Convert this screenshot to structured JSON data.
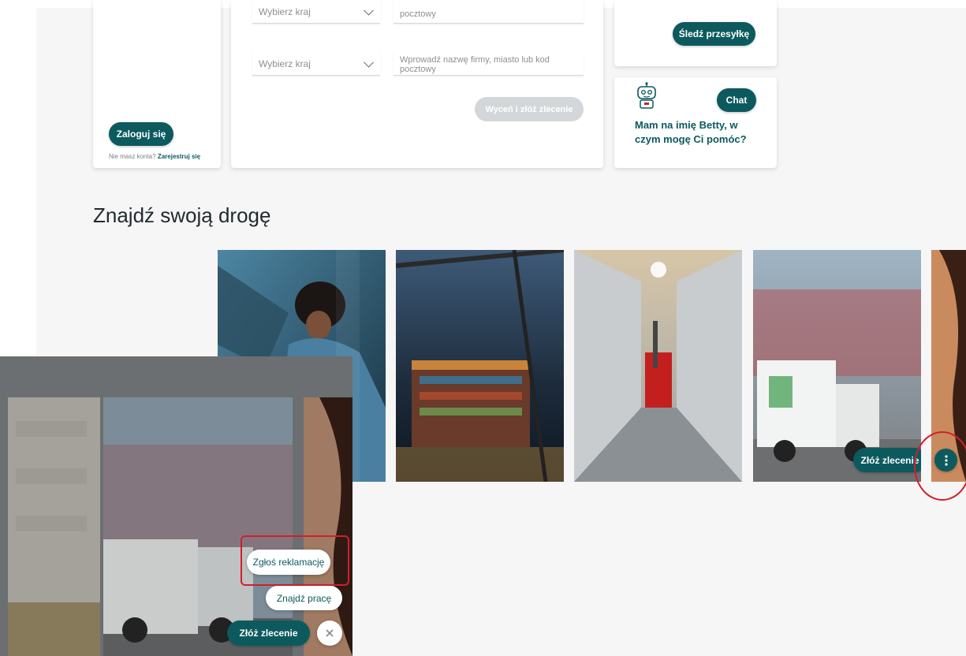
{
  "login": {
    "button": "Zaloguj się",
    "no_account": "Nie masz konta?",
    "register": "Zarejestruj się"
  },
  "quote_form": {
    "row1_country": "Wybierz kraj",
    "row1_field": "pocztowy",
    "row2_country": "Wybierz kraj",
    "row2_field": "Wprowadź nazwę firmy, miasto lub kod pocztowy",
    "submit": "Wyceń i złóż zlecenie"
  },
  "tracking": {
    "button": "Śledź przesyłkę"
  },
  "chat": {
    "button": "Chat",
    "greeting": "Mam na imię Betty, w czym mogę Ci pomóc?"
  },
  "section": {
    "title": "Znajdź swoją drogę"
  },
  "tiles": {
    "order_button": "Złóż zlecenie",
    "more_icon": "more-vertical-icon"
  },
  "zoom_panel": {
    "actions": [
      "Zgłoś reklamację",
      "Znajdź pracę"
    ],
    "order_button": "Złóż zlecenie",
    "close_icon": "close-icon"
  },
  "colors": {
    "brand_teal": "#0c5a5e",
    "highlight_red": "#d21f2b"
  }
}
